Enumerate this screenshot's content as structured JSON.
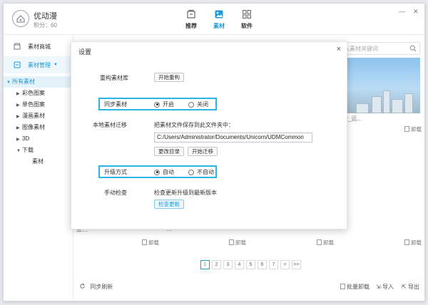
{
  "app": {
    "name": "优动漫",
    "points": "积分：60"
  },
  "nav": {
    "recommend": "推荐",
    "material": "素材",
    "software": "软件"
  },
  "window_controls": {
    "minimize": "—",
    "close": "✕"
  },
  "sidebar": {
    "store": "素材商城",
    "manage": "素材管理",
    "tree": {
      "root": "所有素材",
      "color": "彩色图案",
      "mono": "单色图案",
      "manga": "漫画素材",
      "image": "图像素材",
      "threed": "3D",
      "download": "下载",
      "sucai": "素材"
    }
  },
  "search": {
    "placeholder": "入素材关键词"
  },
  "content": {
    "thumb_caption": "02_远...",
    "download_label": "卸载",
    "row_labels": [
      "三…",
      "…"
    ]
  },
  "pager": {
    "pages": [
      "1",
      "2",
      "3",
      "4",
      "5",
      "6",
      "7"
    ],
    "next": ">",
    "last": ">>",
    "current": "1"
  },
  "bottom": {
    "sync": "同步刷新",
    "batch": "批量卸载",
    "import": "导入",
    "export": "导出"
  },
  "dialog": {
    "title": "设置",
    "close": "×",
    "rebuild_label": "重构素材库",
    "rebuild_button": "开始重构",
    "sync_label": "同步素材",
    "sync_on": "开启",
    "sync_off": "关闭",
    "migrate_label": "本地素材迁移",
    "migrate_hint": "把素材文件保存到此文件夹中：",
    "migrate_path": "C:/Users/Administrator/Documents/Unicorn/UDMCommon",
    "change_dir": "更改目录",
    "start_migrate": "开始迁移",
    "upgrade_label": "升级方式",
    "upgrade_auto": "自动",
    "upgrade_manual": "不自动",
    "check_label": "手动检查",
    "check_hint": "检查更新升级到最新版本",
    "check_button": "检查更新"
  },
  "colors": {
    "accent": "#1a9bd7",
    "highlight": "#2bb5e6"
  }
}
